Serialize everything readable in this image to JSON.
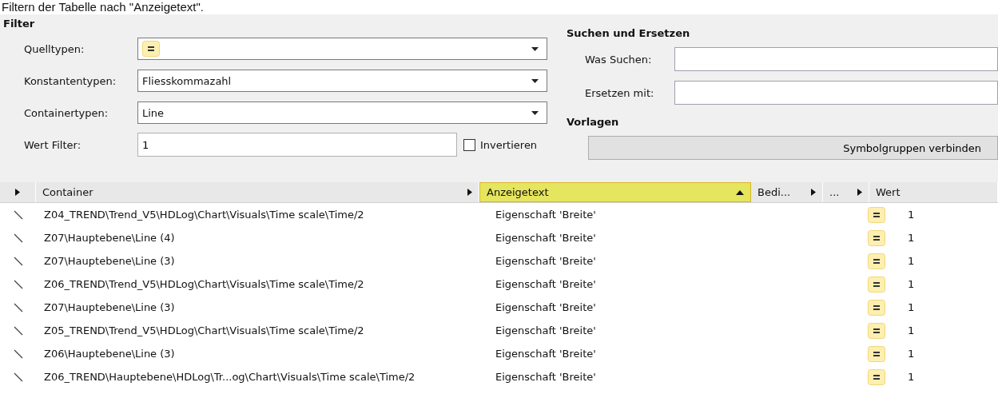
{
  "caption": "Filtern der Tabelle nach \"Anzeigetext\".",
  "filter": {
    "title": "Filter",
    "fields": [
      {
        "kind": "icon-dropdown",
        "label": "Quelltypen:"
      },
      {
        "kind": "dropdown",
        "label": "Konstantentypen:",
        "value": "Fliesskommazahl"
      },
      {
        "kind": "dropdown",
        "label": "Containertypen:",
        "value": "Line"
      },
      {
        "kind": "text",
        "label": "Wert Filter:",
        "value": "1"
      }
    ],
    "invert": {
      "label": "Invertieren",
      "checked": false
    }
  },
  "search": {
    "title": "Suchen und Ersetzen",
    "fields": [
      {
        "label": "Was Suchen:"
      },
      {
        "label": "Ersetzen mit:"
      }
    ]
  },
  "templates": {
    "title": "Vorlagen",
    "button": "Symbolgruppen verbinden"
  },
  "table": {
    "columns": [
      {
        "kind": "expander",
        "selected": false
      },
      {
        "kind": "label",
        "label": "Container",
        "expander": true,
        "selected": false
      },
      {
        "kind": "label",
        "label": "Anzeigetext",
        "sorted": true,
        "selected": true
      },
      {
        "kind": "label",
        "label": "Bedi...",
        "expander": true,
        "selected": false
      },
      {
        "kind": "label",
        "label": "...",
        "expander": true,
        "selected": false
      },
      {
        "kind": "label",
        "label": "Wert",
        "selected": false
      }
    ],
    "rows": [
      {
        "container": "Z04_TREND\\Trend_V5\\HDLog\\Chart\\Visuals\\Time scale\\Time/2",
        "text": "Eigenschaft 'Breite'",
        "value": "1"
      },
      {
        "container": "Z07\\Hauptebene\\Line (4)",
        "text": "Eigenschaft 'Breite'",
        "value": "1"
      },
      {
        "container": "Z07\\Hauptebene\\Line (3)",
        "text": "Eigenschaft 'Breite'",
        "value": "1"
      },
      {
        "container": "Z06_TREND\\Trend_V5\\HDLog\\Chart\\Visuals\\Time scale\\Time/2",
        "text": "Eigenschaft 'Breite'",
        "value": "1"
      },
      {
        "container": "Z07\\Hauptebene\\Line (3)",
        "text": "Eigenschaft 'Breite'",
        "value": "1"
      },
      {
        "container": "Z05_TREND\\Trend_V5\\HDLog\\Chart\\Visuals\\Time scale\\Time/2",
        "text": "Eigenschaft 'Breite'",
        "value": "1"
      },
      {
        "container": "Z06\\Hauptebene\\Line (3)",
        "text": "Eigenschaft 'Breite'",
        "value": "1"
      },
      {
        "container": "Z06_TREND\\Hauptebene\\HDLog\\Tr...og\\Chart\\Visuals\\Time scale\\Time/2",
        "text": "Eigenschaft 'Breite'",
        "value": "1"
      }
    ]
  }
}
